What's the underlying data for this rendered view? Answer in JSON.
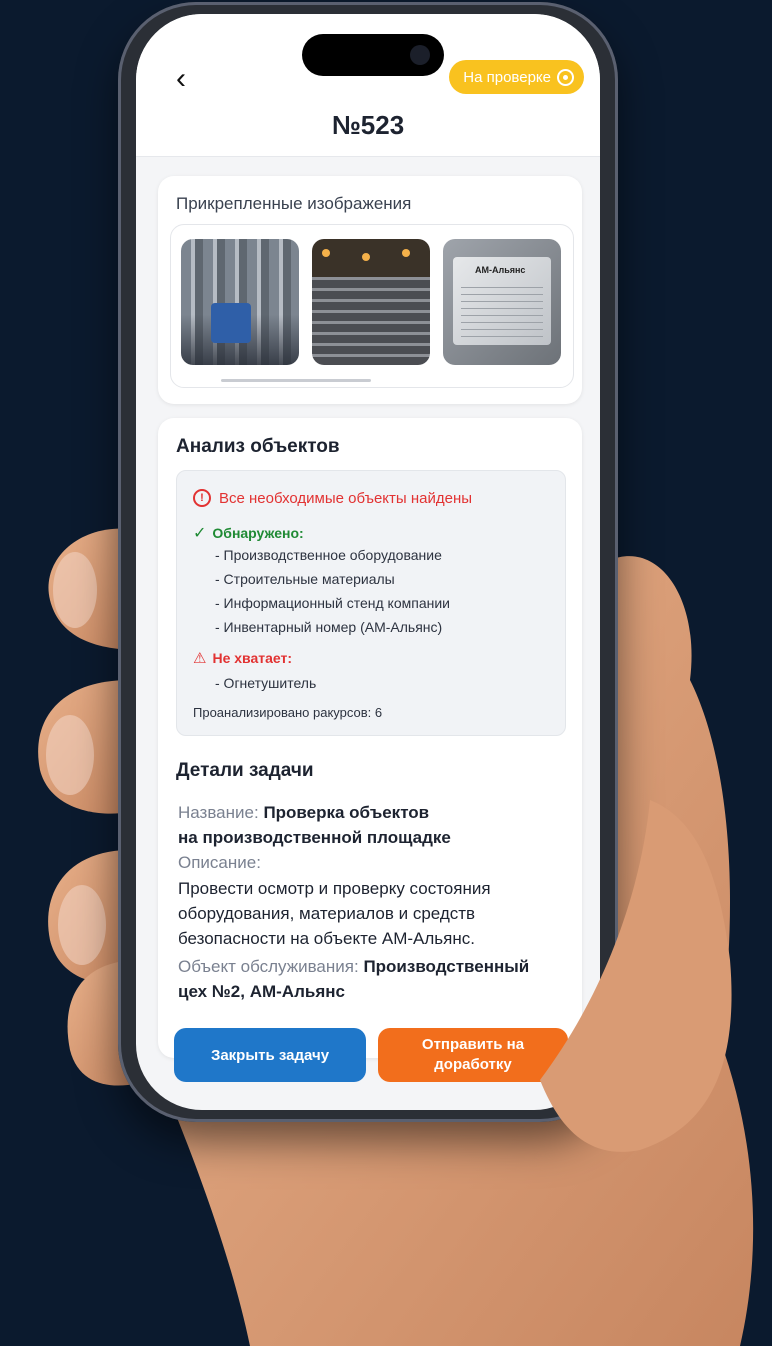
{
  "header": {
    "title": "№523",
    "status": "На проверке"
  },
  "images": {
    "title": "Прикрепленные изображения"
  },
  "analysis": {
    "title": "Анализ объектов",
    "alert": "Все необходимые объекты найдены",
    "found_label": "Обнаружено:",
    "found_items": [
      "- Производственное оборудование",
      "- Строительные материалы",
      "- Информационный стенд компании",
      "- Инвентарный номер (АМ-Альянс)"
    ],
    "missing_label": "Не хватает:",
    "missing_items": [
      "- Огнетушитель"
    ],
    "angles": "Проанализировано ракурсов: 6"
  },
  "details": {
    "title": "Детали задачи",
    "name_label": "Название:",
    "name_value_1": "Проверка объектов",
    "name_value_2": "на производственной площадке",
    "desc_label": "Описание:",
    "desc_value": "Провести осмотр и проверку состояния оборудования, материалов и средств безопасности на объекте АМ-Альянс.",
    "object_label": "Объект обслуживания:",
    "object_value_1": "Производственный",
    "object_value_2": "цех №2, АМ-Альянс"
  },
  "actions": {
    "close": "Закрыть задачу",
    "rework": "Отправить на доработку"
  },
  "plate_logo": "АМ-Альянс",
  "colors": {
    "background": "#0b1a2e",
    "status": "#f9c21f",
    "primary": "#1f77c9",
    "secondary": "#f26e1c",
    "found": "#1f8a34",
    "alert": "#e23232"
  }
}
